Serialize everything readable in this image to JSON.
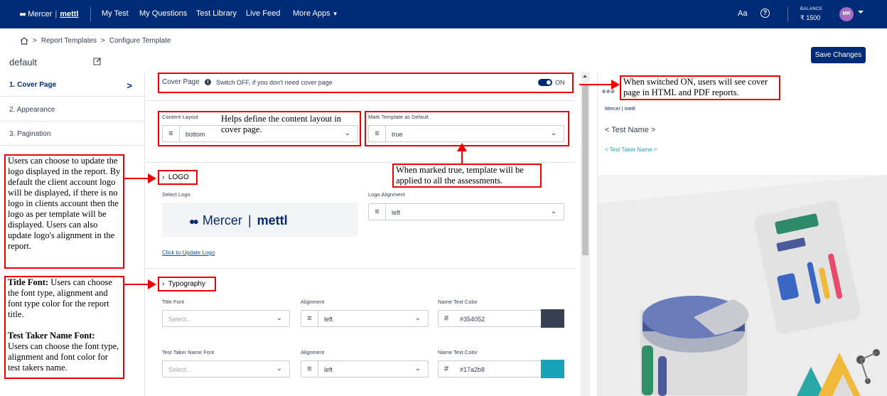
{
  "nav": {
    "brand": "Mercer",
    "brand_sep": "|",
    "brand_product": "mettl",
    "items": [
      "My Test",
      "My Questions",
      "Test Library",
      "Live Feed",
      "More Apps"
    ],
    "font_toggle": "Aa",
    "help": "?",
    "balance_label": "BALANCE",
    "balance_value": "₹ 1500",
    "avatar": "MR"
  },
  "breadcrumb": {
    "sep": ">",
    "items": [
      "Report Templates",
      "Configure Template"
    ]
  },
  "page": {
    "title": "default",
    "save_label": "Save Changes"
  },
  "sidebar": {
    "items": [
      {
        "label": "1. Cover Page",
        "active": true
      },
      {
        "label": "2. Appearance"
      },
      {
        "label": "3. Pagination"
      }
    ],
    "chevron": ">"
  },
  "cover": {
    "label": "Cover Page",
    "info": "i",
    "hint": "Switch OFF, if you don't need cover page",
    "state": "ON"
  },
  "layout": {
    "content_layout_label": "Content Layout",
    "content_layout_value": "bottom",
    "default_label": "Mark Template as Default",
    "default_value": "true"
  },
  "logo": {
    "section": "LOGO",
    "select_label": "Select Logo",
    "alignment_label": "Logo Alignment",
    "alignment_value": "left",
    "update_link": "Click to Update Logo",
    "logo_text": "Mercer",
    "logo_sep": "|",
    "logo_product": "mettl"
  },
  "typography": {
    "section": "Typography",
    "title_font_label": "Title Font",
    "title_font_placeholder": "Select...",
    "title_align_label": "Alignment",
    "title_align_value": "left",
    "title_color_label": "Name Text Color",
    "title_color_hash": "#",
    "title_color_value": "#354052",
    "taker_font_label": "Test Taker Name Font",
    "taker_font_placeholder": "Select...",
    "taker_align_label": "Alignment",
    "taker_align_value": "left",
    "taker_color_label": "Name Text Color",
    "taker_color_hash": "#",
    "taker_color_value": "#17a2b8"
  },
  "preview": {
    "logo": "Mercer | mettl",
    "title": "< Test Name >",
    "taker": "< Test Taker Name >"
  },
  "annotations": {
    "cover_note": "When switched ON, users will see cover page in HTML and PDF reports.",
    "layout_note": "Helps define the content layout in cover page.",
    "default_note": "When marked true, template will be applied to all the assessments.",
    "logo_note": "Users can choose to update the logo displayed in the report. By default the client account logo will be displayed, if there is no logo in clients account then the logo as per template will be displayed. Users can also update logo's alignment in the report.",
    "typo_title_head": "Title Font:",
    "typo_title_body": "Users can choose the font type, alignment and font type color for the report title.",
    "typo_taker_head": "Test Taker Name Font:",
    "typo_taker_body": "Users can choose the font type, alignment and font color for test takers name."
  },
  "colors": {
    "nav_bg": "#002c77",
    "annotation": "#ee0000",
    "title_swatch": "#354052",
    "taker_swatch": "#17a2b8"
  }
}
